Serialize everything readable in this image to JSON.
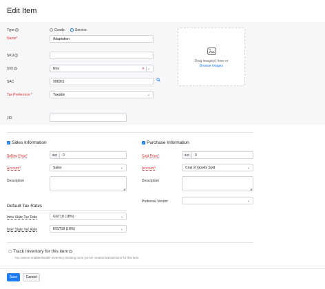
{
  "page": {
    "title": "Edit Item"
  },
  "type_field": {
    "label": "Type",
    "options": [
      "Goods",
      "Service"
    ],
    "selected": "Service"
  },
  "name_field": {
    "label": "Name*",
    "value": "Adaptation"
  },
  "sku_field": {
    "label": "SKU",
    "value": ""
  },
  "unit_field": {
    "label": "Unit",
    "value": "Nos"
  },
  "sac_field": {
    "label": "SAC",
    "value": "998361"
  },
  "tax_pref_field": {
    "label": "Tax Preference *",
    "value": "Taxable"
  },
  "image_upload": {
    "drag_text": "Drag image(s) here or",
    "browse_text": "Browse images"
  },
  "jid_field": {
    "label": "JID",
    "value": ""
  },
  "sales": {
    "heading": "Sales Information",
    "selling_price_label": "Selling Price*",
    "currency": "INR",
    "selling_price": "0",
    "account_label": "Account*",
    "account_value": "Sales",
    "description_label": "Description"
  },
  "purchase": {
    "heading": "Purchase Information",
    "cost_price_label": "Cost Price*",
    "currency": "INR",
    "cost_price": "0",
    "account_label": "Account*",
    "account_value": "Cost of Goods Sold",
    "description_label": "Description",
    "vendor_label": "Preferred Vendor",
    "vendor_value": ""
  },
  "tax_rates": {
    "heading": "Default Tax Rates",
    "intra_label": "Intra State Tax Rate",
    "intra_value": "GST18 (18%)",
    "inter_label": "Inter State Tax Rate",
    "inter_value": "IGST18 (18%)"
  },
  "inventory": {
    "label": "Track Inventory for this item",
    "note": "You cannot enable/disable inventory tracking once you've created transactions for this item"
  },
  "footer": {
    "save_label": "Save",
    "cancel_label": "Cancel"
  },
  "colors": {
    "accent": "#1e7cf2",
    "required": "#d6302f",
    "section_bg": "#f7f7f9"
  }
}
